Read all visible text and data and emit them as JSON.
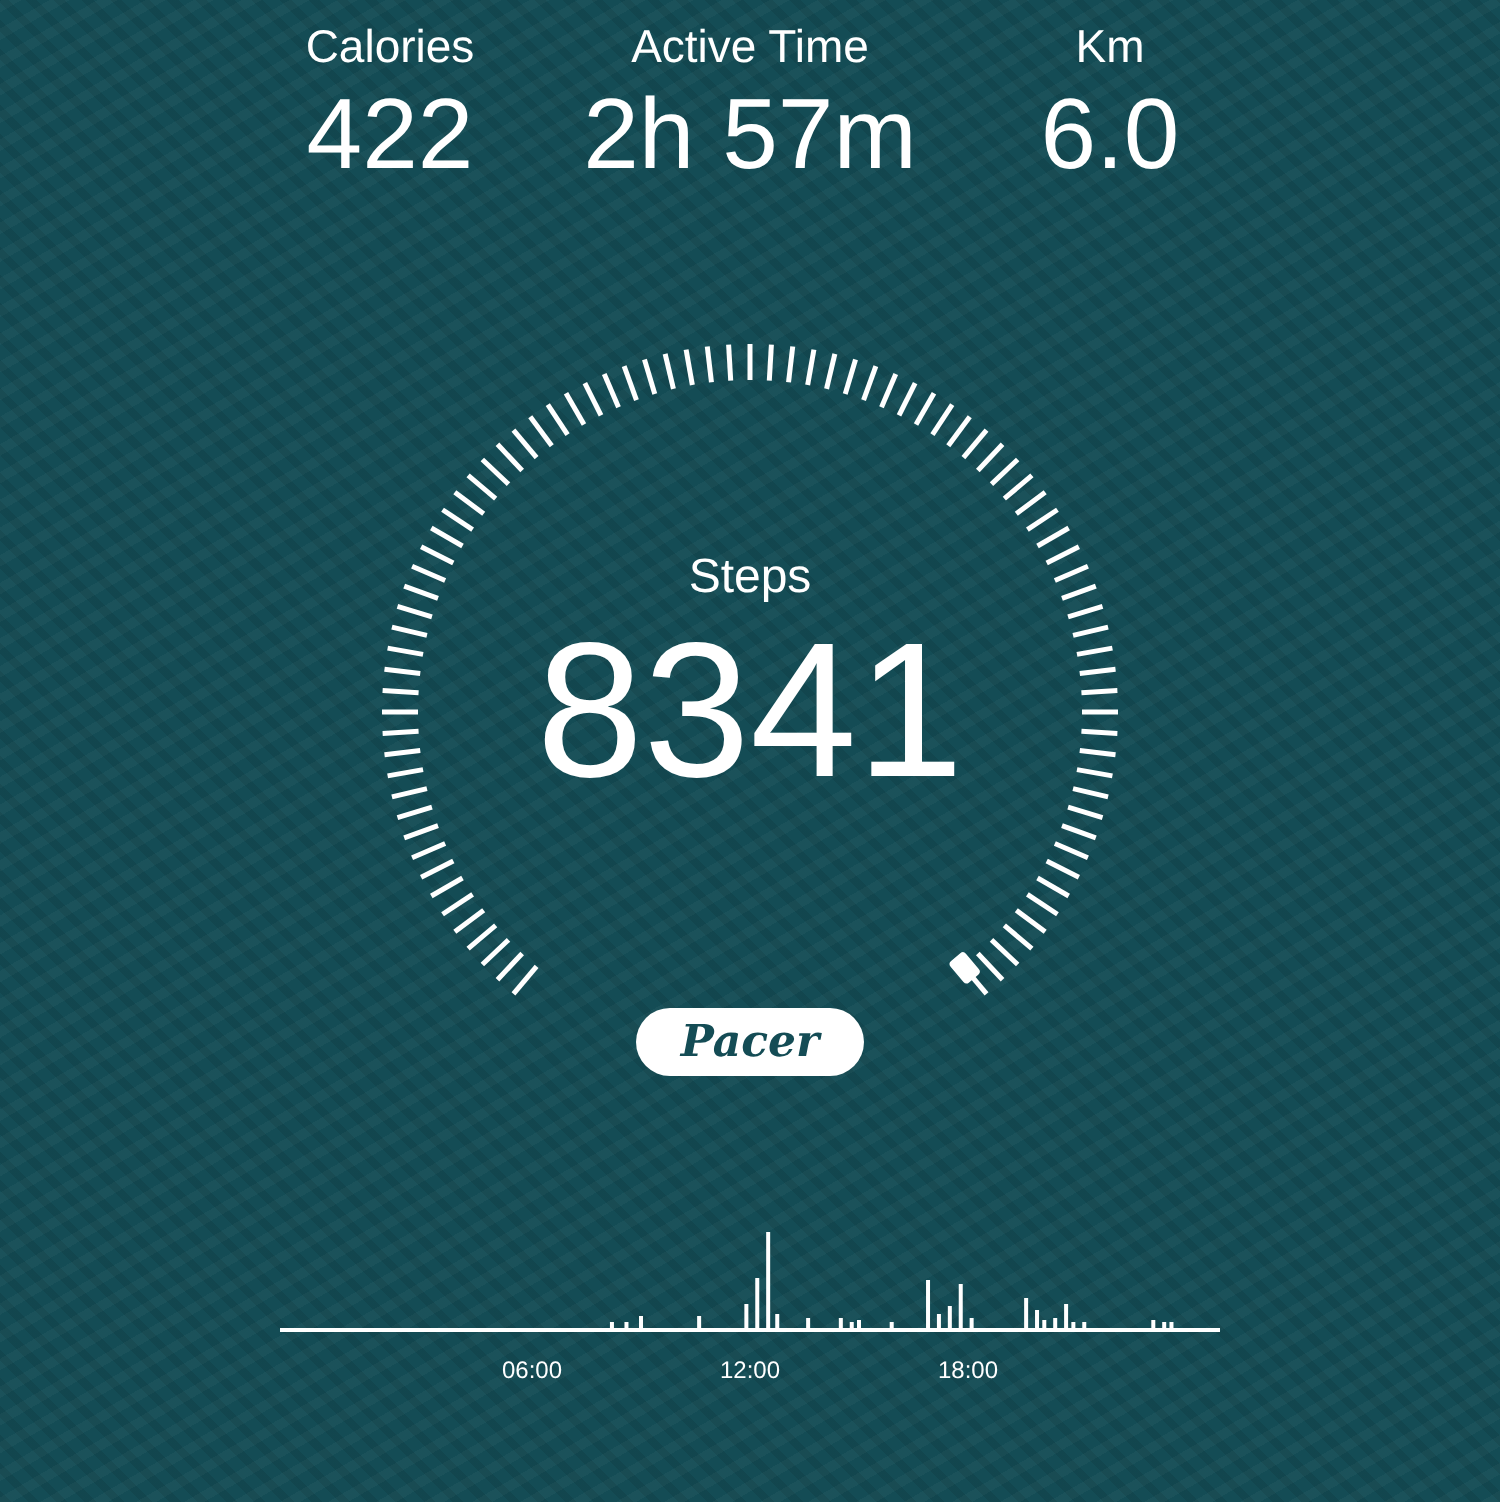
{
  "stats": [
    {
      "label": "Calories",
      "value": "422"
    },
    {
      "label": "Active Time",
      "value": "2h 57m"
    },
    {
      "label": "Km",
      "value": "6.0"
    }
  ],
  "gauge": {
    "label": "Steps",
    "value": "8341"
  },
  "logo": "Pacer",
  "timeline": {
    "ticks": [
      "06:00",
      "12:00",
      "18:00"
    ]
  }
}
